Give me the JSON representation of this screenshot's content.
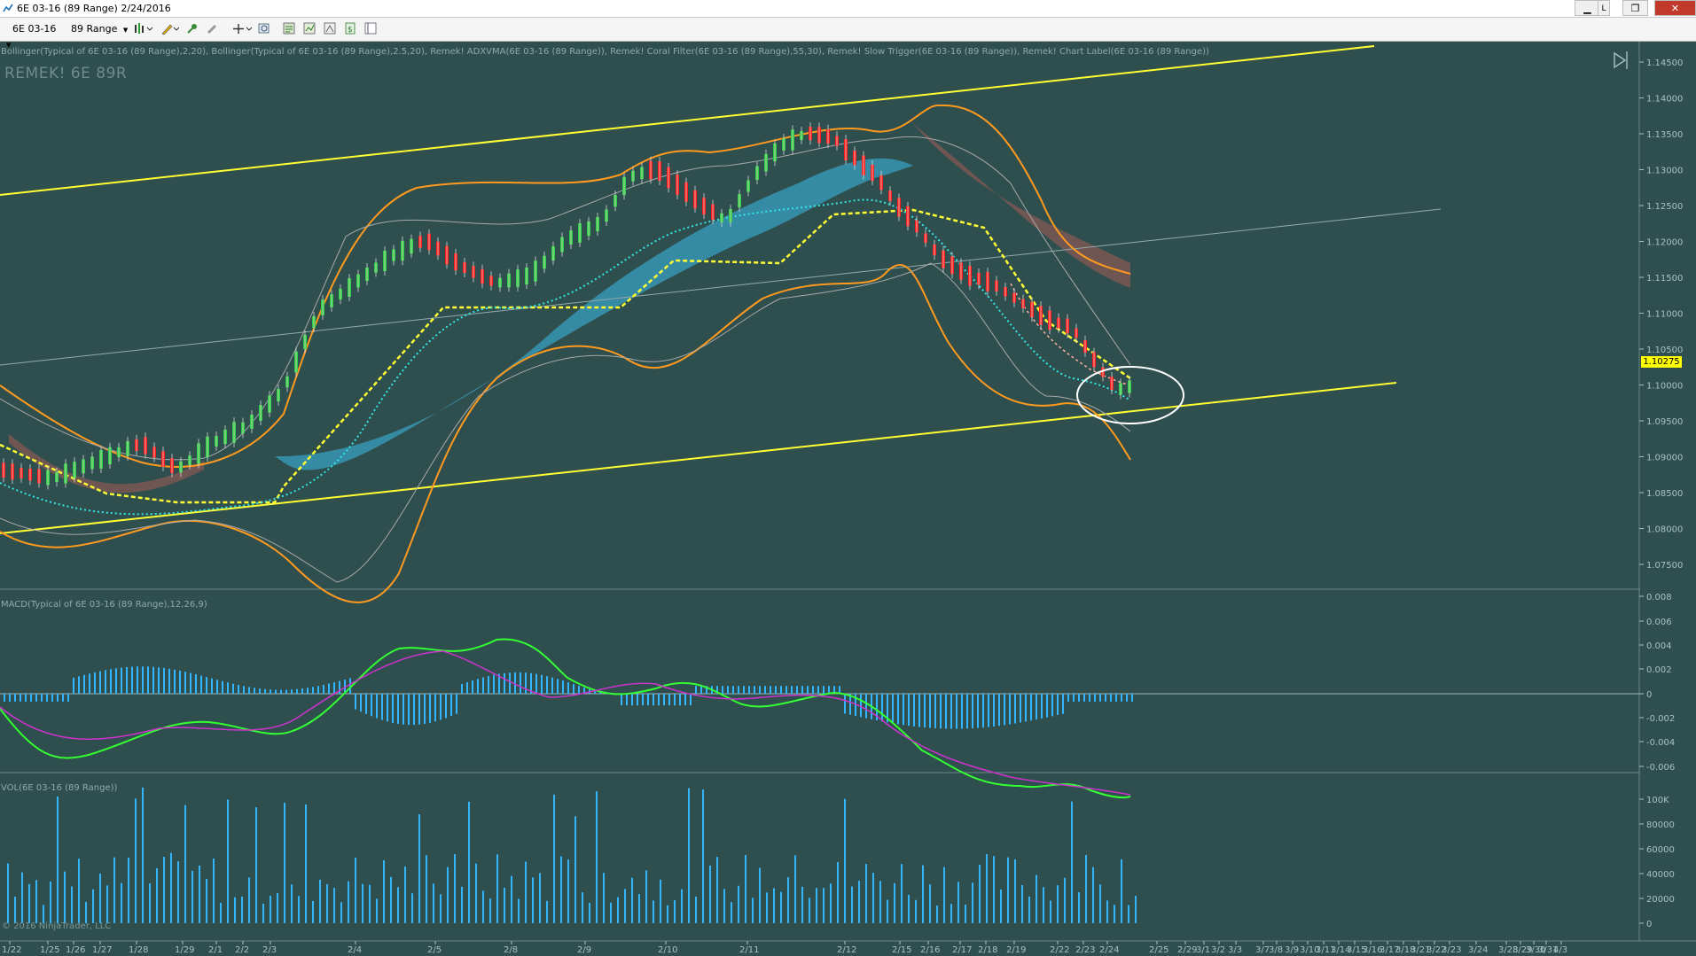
{
  "window": {
    "title": "6E 03-16 (89 Range)  2/24/2016",
    "controls": {
      "minimize": "▁",
      "restore_tab": "L",
      "maximize": "❐",
      "close": "✕"
    }
  },
  "toolbar": {
    "instrument": "6E 03-16",
    "interval": "89 Range",
    "icons": [
      "bar-type-icon",
      "pencil-draw-icon",
      "pin-icon",
      "eraser-icon",
      "crosshair-icon",
      "zoom-icon",
      "properties-icon",
      "indicators-icon",
      "strategies-icon",
      "data-box-icon",
      "chart-trader-icon"
    ]
  },
  "chart": {
    "indicator_line": "Bollinger(Typical of 6E 03-16 (89 Range),2,20), Bollinger(Typical of 6E 03-16 (89 Range),2.5,20), Remek! ADXVMA(6E 03-16 (89 Range)), Remek! Coral Filter(6E 03-16 (89 Range),55,30), Remek! Slow Trigger(6E 03-16 (89 Range)), Remek! Chart Label(6E 03-16 (89 Range))",
    "watermark": "REMEK! 6E 89R",
    "last_price": "1.10275",
    "macd_label": "MACD(Typical of 6E 03-16 (89 Range),12,26,9)",
    "vol_label": "VOL(6E 03-16 (89 Range))",
    "copyright": "© 2016 NinjaTrader, LLC",
    "price_ticks": [
      "1.14500",
      "1.14000",
      "1.13500",
      "1.13000",
      "1.12500",
      "1.12000",
      "1.11500",
      "1.11000",
      "1.10500",
      "1.10000",
      "1.09500",
      "1.09000",
      "1.08500",
      "1.08000",
      "1.07500"
    ],
    "macd_ticks": [
      "0.008",
      "0.006",
      "0.004",
      "0.002",
      "0",
      "-0.002",
      "-0.004",
      "-0.006"
    ],
    "vol_ticks": [
      "100K",
      "80000",
      "60000",
      "40000",
      "20000",
      "0"
    ],
    "date_ticks": [
      "1/22",
      "1/25",
      "1/26",
      "1/27",
      "1/28",
      "1/29",
      "2/1",
      "2/2",
      "2/3",
      "2/4",
      "2/5",
      "2/8",
      "2/9",
      "2/10",
      "2/11",
      "2/12",
      "2/15",
      "2/16",
      "2/17",
      "2/18",
      "2/19",
      "2/22",
      "2/23",
      "2/24",
      "2/25",
      "2/29",
      "3/1",
      "3/2",
      "3/3",
      "3/7",
      "3/8",
      "3/9",
      "3/10",
      "3/11",
      "3/14",
      "3/15",
      "3/16",
      "3/17",
      "3/18",
      "3/21",
      "3/22",
      "3/23",
      "3/24",
      "3/28",
      "3/29",
      "3/30",
      "3/31",
      "4/3"
    ],
    "colors": {
      "background": "#2f4f4f",
      "up_candle": "#2ecc40",
      "down_candle": "#ff1a1a",
      "bollinger_outer": "#ff9a1f",
      "bollinger_inner": "#a8a8a8",
      "channel": "#ffff33",
      "coral_fill": "#3a9fc0",
      "adxvma": "#ffff33",
      "trigger": "#33e6e6",
      "macd": "#33ff33",
      "signal": "#cc33cc",
      "volume": "#33b5ff",
      "price_tag": "#ffff00"
    }
  }
}
